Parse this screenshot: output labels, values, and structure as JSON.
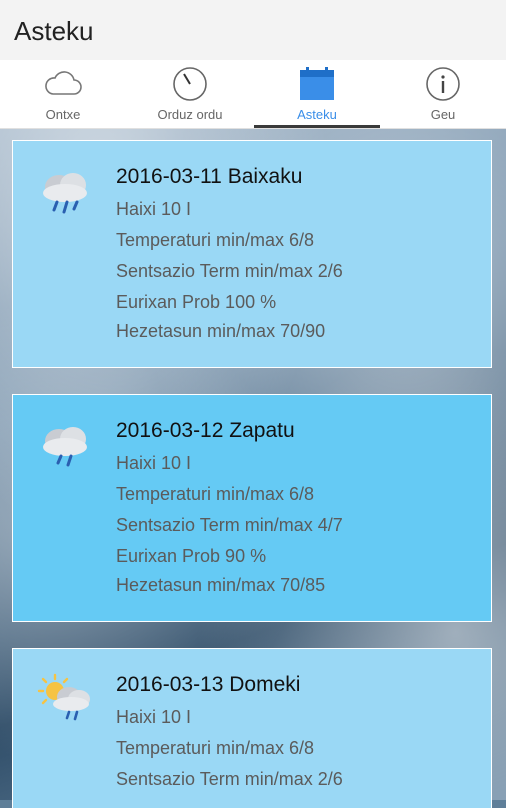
{
  "app": {
    "title": "Asteku"
  },
  "tabs": [
    {
      "label": "Ontxe",
      "icon": "cloud-icon"
    },
    {
      "label": "Orduz ordu",
      "icon": "clock-icon"
    },
    {
      "label": "Asteku",
      "icon": "calendar-icon",
      "active": true
    },
    {
      "label": "Geu",
      "icon": "info-icon"
    }
  ],
  "days": [
    {
      "date": "2016-03-11 Baixaku",
      "wind": "Haixi 10 I",
      "temp": "Temperaturi min/max 6/8",
      "feel": "Sentsazio Term min/max 2/6",
      "rain": "Eurixan Prob 100 %",
      "humidity": "Hezetasun min/max 70/90",
      "icon": "rain-cloud-icon"
    },
    {
      "date": "2016-03-12 Zapatu",
      "wind": "Haixi 10 I",
      "temp": "Temperaturi min/max 6/8",
      "feel": "Sentsazio Term min/max 4/7",
      "rain": "Eurixan Prob 90 %",
      "humidity": "Hezetasun min/max 70/85",
      "icon": "rain-cloud-icon"
    },
    {
      "date": "2016-03-13 Domeki",
      "wind": "Haixi 10 I",
      "temp": "Temperaturi min/max 6/8",
      "feel": "Sentsazio Term min/max 2/6",
      "icon": "sun-rain-cloud-icon"
    }
  ],
  "colors": {
    "accent": "#3a8ee8",
    "card_light": "#9ad8f5",
    "card_dark": "#65caf4"
  }
}
